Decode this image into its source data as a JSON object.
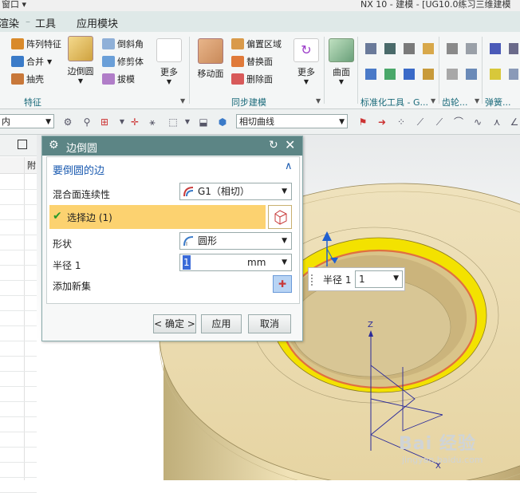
{
  "titlebar": {
    "window_menu": "窗口 ▾",
    "doc_title": "NX 10 - 建模 - [UG10.0练习三维建模"
  },
  "menubar": {
    "items": [
      "渲染",
      "工具",
      "应用模块"
    ]
  },
  "ribbon": {
    "feature_group": {
      "label": "特征",
      "small_buttons": [
        "阵列特征",
        "合并",
        "抽壳",
        "倒斜角",
        "修剪体",
        "拔模"
      ],
      "big_buttons": [
        "边倒圆",
        "更多"
      ]
    },
    "sync_group": {
      "label": "同步建模",
      "small_buttons": [
        "偏置区域",
        "替换面",
        "删除面"
      ],
      "big_buttons": [
        "移动面",
        "更多"
      ]
    },
    "curve_button": "曲面",
    "standard_group": {
      "label": "标准化工具 - G..."
    },
    "gear_group": {
      "label": "齿轮..."
    },
    "spring_group": {
      "label": "弹簧..."
    }
  },
  "seltoolbar": {
    "filter_value": "内",
    "curve_rule_value": "相切曲线"
  },
  "dialog": {
    "title": "边倒圆",
    "section_title": "要倒圆的边",
    "blend_continuity_label": "混合面连续性",
    "blend_continuity_value": "G1（相切）",
    "select_edge_label": "选择边 (1)",
    "shape_label": "形状",
    "shape_value": "圆形",
    "radius_label": "半径 1",
    "radius_value": "1",
    "radius_unit": "mm",
    "add_new_set_label": "添加新集",
    "ok_button": "< 确定 >",
    "apply_button": "应用",
    "cancel_button": "取消"
  },
  "radius_float": {
    "label": "半径 1",
    "value": "1"
  },
  "viewport": {
    "axis_z_label": "Z",
    "axis_x_label": "X"
  },
  "nav": {
    "header_mark": "附"
  },
  "watermark": {
    "brand": "Bai 经验",
    "url": "jingyan.baidu.com"
  },
  "colors": {
    "dialog_title": "#5c8585",
    "selection_highlight": "#fcd270",
    "ring_face": "#f3e200",
    "part_body": "#e8d8a4"
  }
}
